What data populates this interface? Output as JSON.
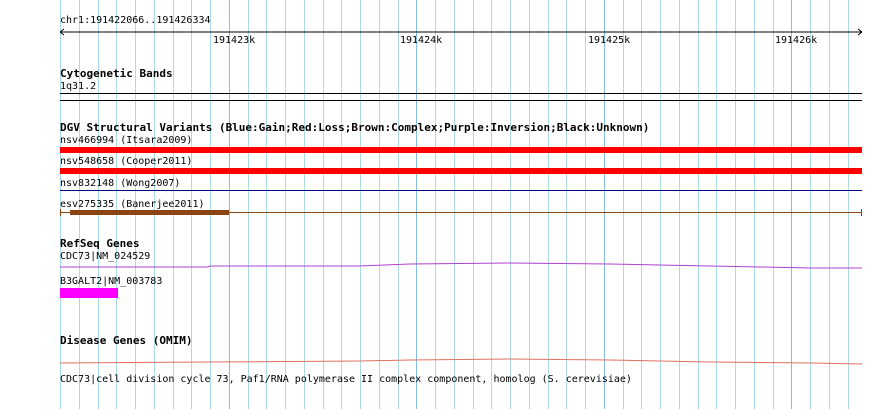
{
  "ruler": {
    "locus": "chr1:191422066..191426334",
    "ticks": [
      "191423k",
      "191424k",
      "191425k",
      "191426k"
    ]
  },
  "tracks": {
    "cytoband": {
      "title": "Cytogenetic Bands",
      "band": "1q31.2"
    },
    "dgv": {
      "title": "DGV Structural Variants (Blue:Gain;Red:Loss;Brown:Complex;Purple:Inversion;Black:Unknown)",
      "variants": [
        {
          "label": "nsv466994 (Itsara2009)",
          "type": "Loss",
          "color": "#ff0000"
        },
        {
          "label": "nsv548658 (Cooper2011)",
          "type": "Loss",
          "color": "#ff0000"
        },
        {
          "label": "nsv832148 (Wong2007)",
          "type": "Gain",
          "color": "#000080"
        },
        {
          "label": "esv275335 (Banerjee2011)",
          "type": "Complex",
          "color": "#8b4513"
        }
      ]
    },
    "refseq": {
      "title": "RefSeq Genes",
      "genes": [
        {
          "label": "CDC73|NM_024529",
          "color": "#b040d0"
        },
        {
          "label": "B3GALT2|NM_003783",
          "color": "#ff00ff"
        }
      ]
    },
    "omim": {
      "title": "Disease Genes (OMIM)",
      "entry": "CDC73|cell division cycle 73, Paf1/RNA polymerase II complex component, homolog (S. cerevisiae)",
      "color": "#e07060"
    }
  },
  "colors": {
    "grid": "#add8e6",
    "grid_major": "#87bede"
  }
}
